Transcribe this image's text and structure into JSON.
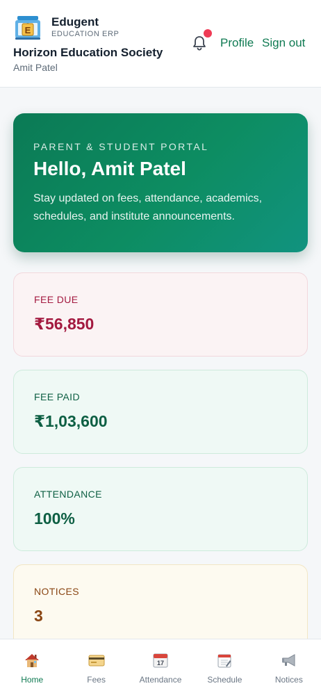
{
  "header": {
    "brand_name": "Edugent",
    "brand_subtitle": "EDUCATION ERP",
    "organization": "Horizon Education Society",
    "user": "Amit Patel",
    "profile_link": "Profile",
    "signout_link": "Sign out",
    "notification_icon": "bell-icon",
    "notification_badge_color": "#ef3b55"
  },
  "hero": {
    "kicker": "PARENT & STUDENT PORTAL",
    "title": "Hello, Amit Patel",
    "description": "Stay updated on fees, attendance, academics, schedules, and institute announcements."
  },
  "stats": {
    "fee_due": {
      "label": "FEE DUE",
      "value": "₹56,850"
    },
    "fee_paid": {
      "label": "FEE PAID",
      "value": "₹1,03,600"
    },
    "attendance": {
      "label": "ATTENDANCE",
      "value": "100%"
    },
    "notices": {
      "label": "NOTICES",
      "value": "3"
    }
  },
  "bottom_nav": {
    "items": [
      {
        "label": "Home",
        "icon": "house-icon",
        "active": true
      },
      {
        "label": "Fees",
        "icon": "credit-card-icon",
        "active": false
      },
      {
        "label": "Attendance",
        "icon": "calendar-icon",
        "active": false
      },
      {
        "label": "Schedule",
        "icon": "spiral-notepad-icon",
        "active": false
      },
      {
        "label": "Notices",
        "icon": "megaphone-icon",
        "active": false
      }
    ]
  },
  "colors": {
    "accent": "#0f7a52",
    "hero_gradient_start": "#0b7a55",
    "hero_gradient_end": "#11937f",
    "due": "#a3193f",
    "paid": "#0d5f43",
    "notices": "#8a4614"
  }
}
